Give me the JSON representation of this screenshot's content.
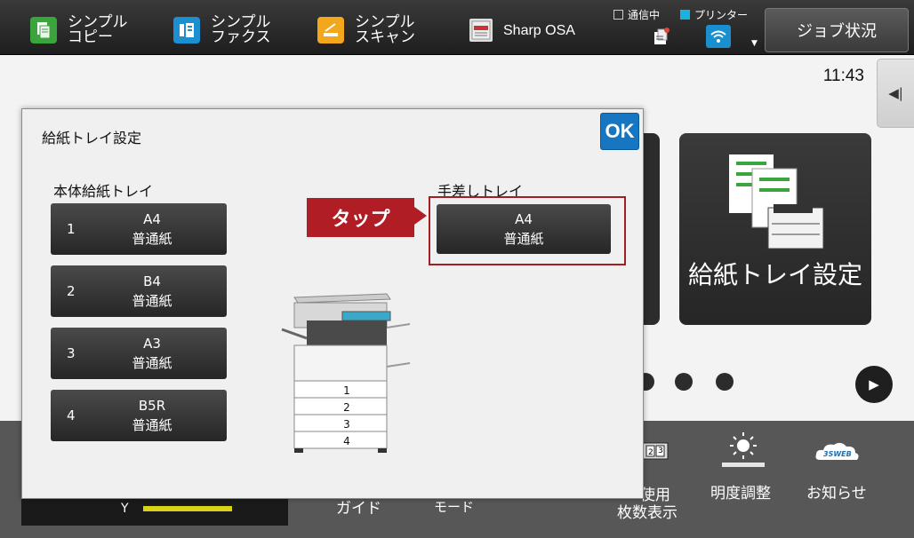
{
  "topbar": {
    "apps": [
      {
        "line1": "シンプル",
        "line2": "コピー"
      },
      {
        "line1": "シンプル",
        "line2": "ファクス"
      },
      {
        "line1": "シンプル",
        "line2": "スキャン"
      },
      {
        "label": "Sharp OSA"
      }
    ],
    "status_comm": "通信中",
    "status_printer": "プリンター",
    "job_status": "ジョブ状況"
  },
  "home": {
    "clock": "11:43",
    "tile_label": "給紙トレイ設定",
    "bottom": {
      "guide": "ガイド",
      "mode": "モード",
      "count_line1": "使用",
      "count_line2": "枚数表示",
      "brightness": "明度調整",
      "notice": "お知らせ",
      "toner_label": "Y"
    }
  },
  "dialog": {
    "title": "給紙トレイ設定",
    "ok_label": "OK",
    "main_tray_label": "本体給紙トレイ",
    "bypass_label": "手差しトレイ",
    "trays": [
      {
        "num": "1",
        "size": "A4",
        "type": "普通紙"
      },
      {
        "num": "2",
        "size": "B4",
        "type": "普通紙"
      },
      {
        "num": "3",
        "size": "A3",
        "type": "普通紙"
      },
      {
        "num": "4",
        "size": "B5R",
        "type": "普通紙"
      }
    ],
    "bypass": {
      "size": "A4",
      "type": "普通紙"
    },
    "tap_callout": "タップ",
    "printer_tray_numbers": [
      "1",
      "2",
      "3",
      "4"
    ]
  }
}
